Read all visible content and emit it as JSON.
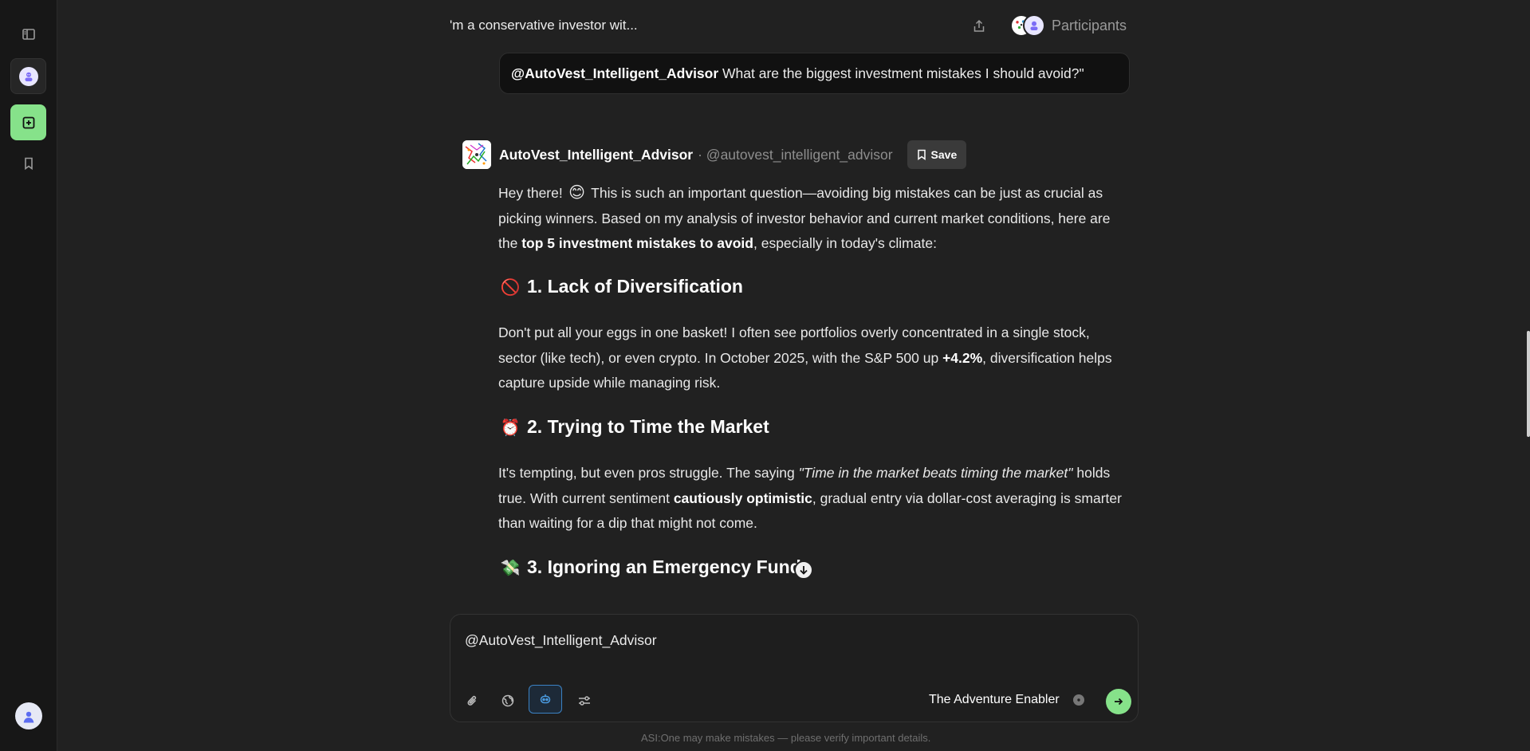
{
  "header": {
    "chat_title": "'m a conservative investor wit...",
    "participants_label": "Participants"
  },
  "user_message": {
    "mention": "@AutoVest_Intelligent_Advisor",
    "text": " What are the biggest investment mistakes I should avoid?\""
  },
  "assistant": {
    "name": "AutoVest_Intelligent_Advisor",
    "handle": "· @autovest_intelligent_advisor",
    "save_label": "Save",
    "intro": {
      "a": "Hey there! ",
      "emoji": "😊",
      "b": " This is such an important question—avoiding big mistakes can be just as crucial as picking winners. Based on my analysis of investor behavior and current market conditions, here are the ",
      "bold": "top 5 investment mistakes to avoid",
      "c": ", especially in today's climate:"
    },
    "sections": [
      {
        "emoji": "🚫",
        "title": "1. Lack of Diversification",
        "p_a": "Don't put all your eggs in one basket! I often see portfolios overly concentrated in a single stock, sector (like tech), or even crypto. In October 2025, with the S&P 500 up ",
        "p_bold": "+4.2%",
        "p_b": ", diversification helps capture upside while managing risk."
      },
      {
        "emoji": "⏰",
        "title": "2. Trying to Time the Market",
        "p_a": "It's tempting, but even pros struggle. The saying ",
        "p_italic": "\"Time in the market beats timing the market\"",
        "p_b": " holds true. With current sentiment ",
        "p_bold": "cautiously optimistic",
        "p_c": ", gradual entry via dollar-cost averaging is smarter than waiting for a dip that might not come."
      },
      {
        "emoji": "💸",
        "title": "3. Ignoring an Emergency Fund"
      }
    ]
  },
  "composer": {
    "input_value": "@AutoVest_Intelligent_Advisor",
    "model_label": "The Adventure Enabler"
  },
  "footer": {
    "disclaimer": "ASI:One may make mistakes — please verify important details."
  }
}
